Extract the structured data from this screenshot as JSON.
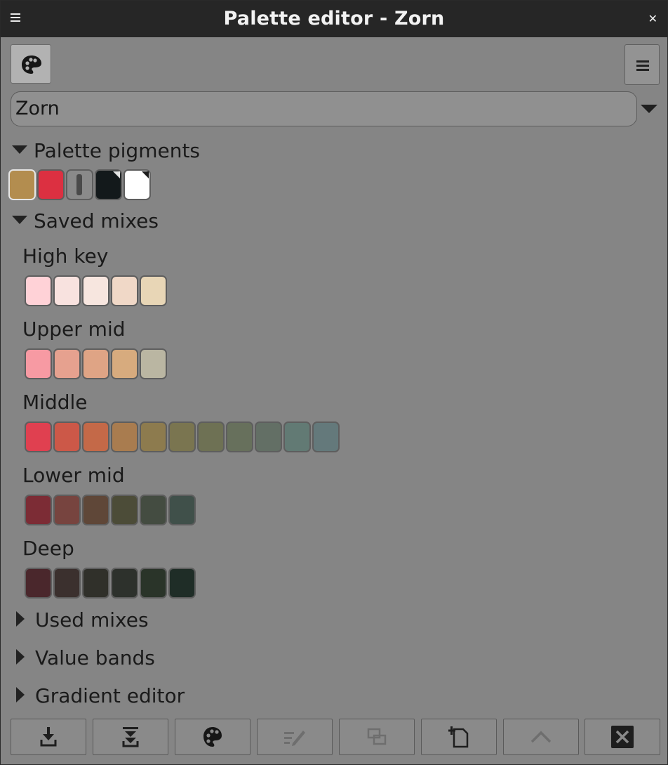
{
  "window": {
    "title": "Palette editor - Zorn"
  },
  "palette_select": {
    "value": "Zorn"
  },
  "sections": {
    "pigments": {
      "label": "Palette pigments",
      "expanded": true
    },
    "saved": {
      "label": "Saved mixes",
      "expanded": true
    },
    "used": {
      "label": "Used mixes",
      "expanded": false
    },
    "value_bands": {
      "label": "Value bands",
      "expanded": false
    },
    "gradient": {
      "label": "Gradient editor",
      "expanded": false
    }
  },
  "pigments": [
    {
      "color": "#b38d4f",
      "selected": true
    },
    {
      "color": "#dc3041"
    },
    {
      "color": "#8a8a8a",
      "kind": "divider"
    },
    {
      "color": "#13191b",
      "marker": "corner"
    },
    {
      "color": "#ffffff",
      "marker": "corner"
    }
  ],
  "saved_mixes": [
    {
      "label": "High key",
      "colors": [
        "#ffd2d7",
        "#f8e2df",
        "#f7e6df",
        "#f0d8c7",
        "#e8d6b6"
      ]
    },
    {
      "label": "Upper mid",
      "colors": [
        "#f79aa3",
        "#e6a18f",
        "#dfa485",
        "#d7ab7e",
        "#bab6a2"
      ]
    },
    {
      "label": "Middle",
      "colors": [
        "#e04050",
        "#cc5848",
        "#c46948",
        "#a97c4f",
        "#8d7b4e",
        "#7a7550",
        "#6e7154",
        "#67705c",
        "#636f65",
        "#627a74",
        "#64797b"
      ]
    },
    {
      "label": "Lower mid",
      "colors": [
        "#7c2c35",
        "#77443f",
        "#5f4738",
        "#4c4c38",
        "#444c41",
        "#40504a"
      ]
    },
    {
      "label": "Deep",
      "colors": [
        "#4a272c",
        "#3b302e",
        "#30302a",
        "#2d312c",
        "#2a3429",
        "#1f2d27"
      ]
    }
  ],
  "bottom_toolbar": [
    {
      "icon": "import-icon",
      "enabled": true
    },
    {
      "icon": "import-merge-icon",
      "enabled": true
    },
    {
      "icon": "palette-icon",
      "enabled": true
    },
    {
      "icon": "edit-icon",
      "enabled": false
    },
    {
      "icon": "duplicate-icon",
      "enabled": false
    },
    {
      "icon": "new-palette-icon",
      "enabled": true
    },
    {
      "icon": "move-up-icon",
      "enabled": false
    },
    {
      "icon": "delete-icon",
      "enabled": true
    }
  ]
}
